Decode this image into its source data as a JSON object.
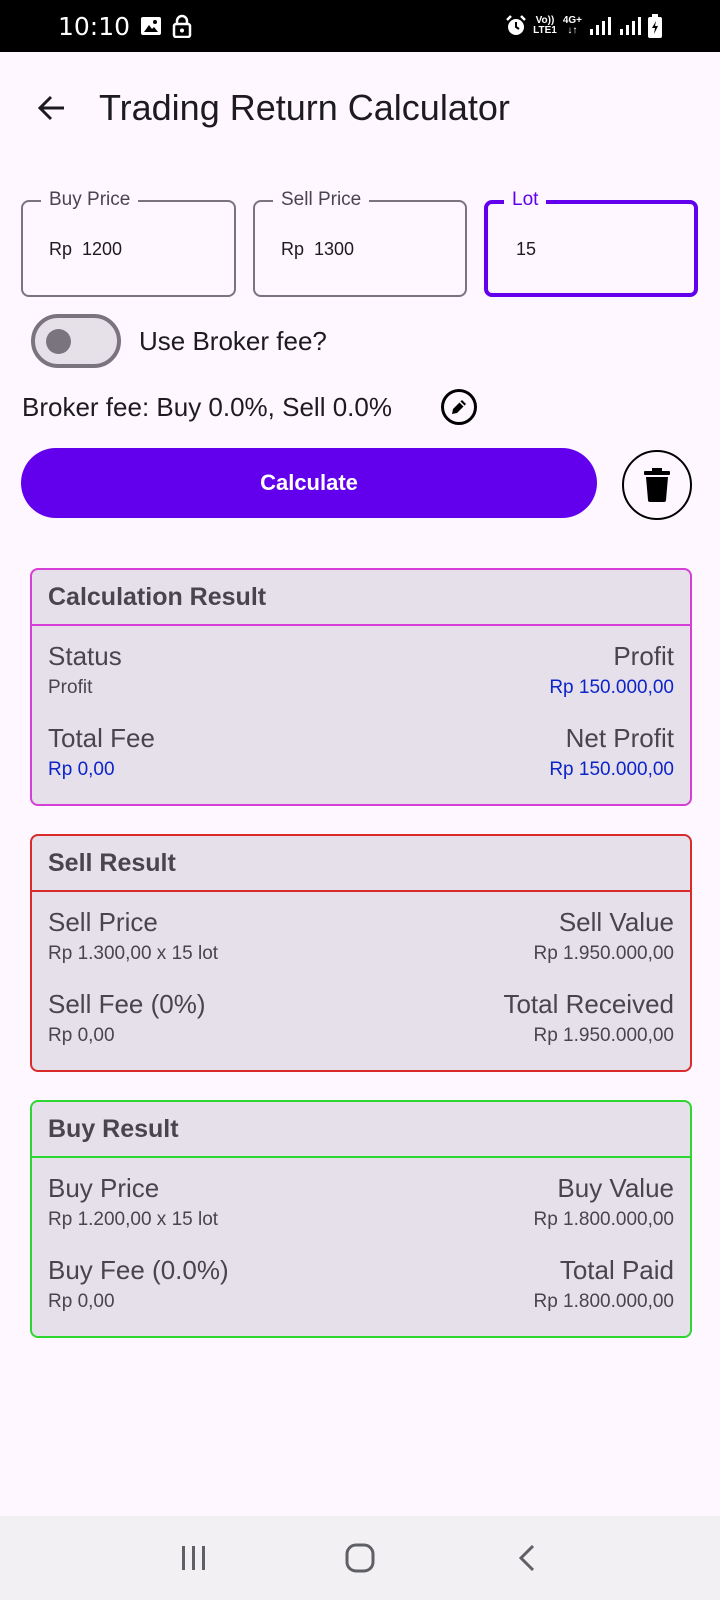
{
  "status_bar": {
    "time": "10:10",
    "net_top": "Vo))",
    "net_bottom": "LTE1",
    "net_type": "4G+",
    "icons": [
      "image-icon",
      "lock-icon",
      "alarm-icon",
      "signal-icon",
      "signal-icon",
      "battery-icon"
    ]
  },
  "app_bar": {
    "title": "Trading Return Calculator",
    "back_icon": "arrow-back-icon"
  },
  "inputs": {
    "buy_price": {
      "label": "Buy Price",
      "prefix": "Rp",
      "value": "1200"
    },
    "sell_price": {
      "label": "Sell Price",
      "prefix": "Rp",
      "value": "1300"
    },
    "lot": {
      "label": "Lot",
      "value": "15"
    }
  },
  "broker_toggle": {
    "label": "Use Broker fee?",
    "checked": false
  },
  "broker_fee_text": "Broker fee: Buy 0.0%, Sell 0.0%",
  "calculate_label": "Calculate",
  "calculation_result": {
    "title": "Calculation Result",
    "status_label": "Status",
    "status_value": "Profit",
    "profit_label": "Profit",
    "profit_value": "Rp 150.000,00",
    "total_fee_label": "Total Fee",
    "total_fee_value": "Rp 0,00",
    "net_profit_label": "Net Profit",
    "net_profit_value": "Rp 150.000,00"
  },
  "sell_result": {
    "title": "Sell Result",
    "price_label": "Sell Price",
    "price_value": "Rp 1.300,00 x 15 lot",
    "value_label": "Sell Value",
    "value_value": "Rp 1.950.000,00",
    "fee_label": "Sell Fee (0%)",
    "fee_value": "Rp 0,00",
    "total_label": "Total Received",
    "total_value": "Rp 1.950.000,00"
  },
  "buy_result": {
    "title": "Buy Result",
    "price_label": "Buy Price",
    "price_value": "Rp 1.200,00 x 15 lot",
    "value_label": "Buy Value",
    "value_value": "Rp 1.800.000,00",
    "fee_label": "Buy Fee (0.0%)",
    "fee_value": "Rp 0,00",
    "total_label": "Total Paid",
    "total_value": "Rp 1.800.000,00"
  },
  "colors": {
    "primary": "#6200ee",
    "calc_card_border": "#d63fd6",
    "sell_card_border": "#d92b2b",
    "buy_card_border": "#2ed630",
    "value_blue": "#0d24c8"
  }
}
